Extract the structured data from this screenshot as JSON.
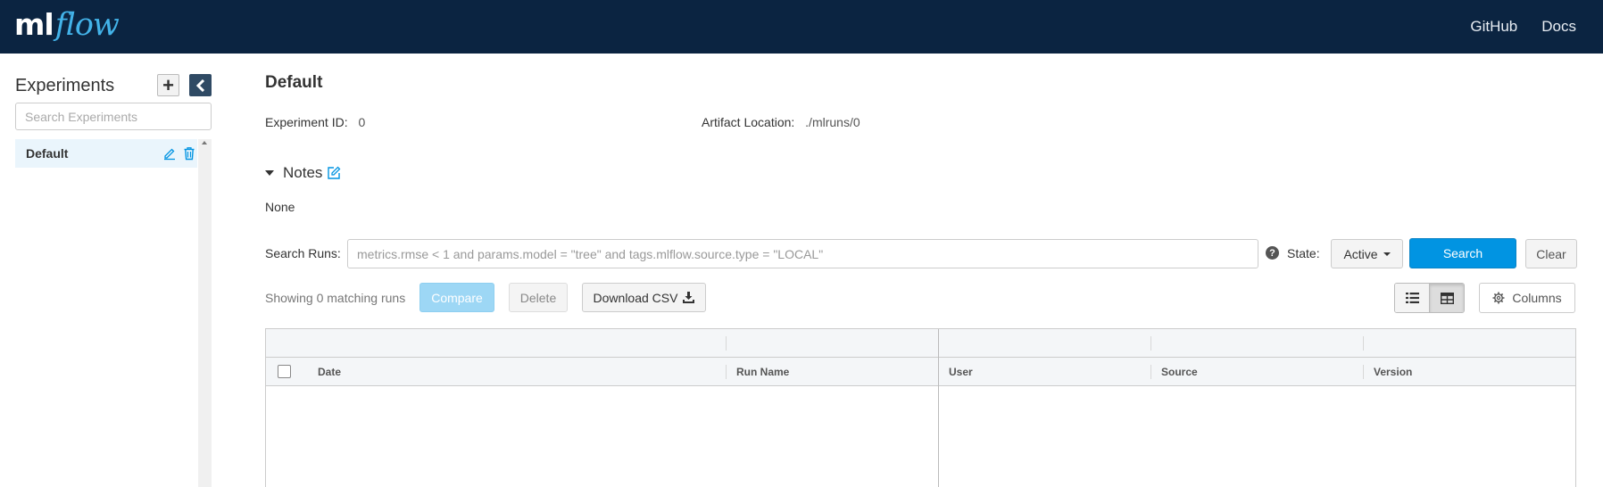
{
  "header": {
    "logo_ml": "ml",
    "logo_flow": "flow",
    "links": [
      "GitHub",
      "Docs"
    ]
  },
  "sidebar": {
    "title": "Experiments",
    "search_placeholder": "Search Experiments",
    "items": [
      {
        "label": "Default",
        "selected": true
      }
    ]
  },
  "experiment": {
    "title": "Default",
    "id_label": "Experiment ID:",
    "id_value": "0",
    "artifact_label": "Artifact Location:",
    "artifact_value": "./mlruns/0",
    "notes_label": "Notes",
    "notes_text": "None"
  },
  "search": {
    "label": "Search Runs:",
    "placeholder": "metrics.rmse < 1 and params.model = \"tree\" and tags.mlflow.source.type = \"LOCAL\"",
    "help_icon": "?",
    "state_label": "State:",
    "state_value": "Active",
    "search_button": "Search",
    "clear_button": "Clear"
  },
  "toolbar": {
    "showing_text": "Showing 0 matching runs",
    "compare_button": "Compare",
    "delete_button": "Delete",
    "download_button": "Download CSV",
    "columns_button": "Columns",
    "view_mode": "table"
  },
  "table": {
    "columns": [
      "Date",
      "Run Name",
      "User",
      "Source",
      "Version"
    ],
    "rows": []
  },
  "colors": {
    "header_bg": "#0b2441",
    "accent": "#0194e2",
    "logo_flow": "#43b3e9",
    "selected_item_bg": "#eaf5fc"
  }
}
